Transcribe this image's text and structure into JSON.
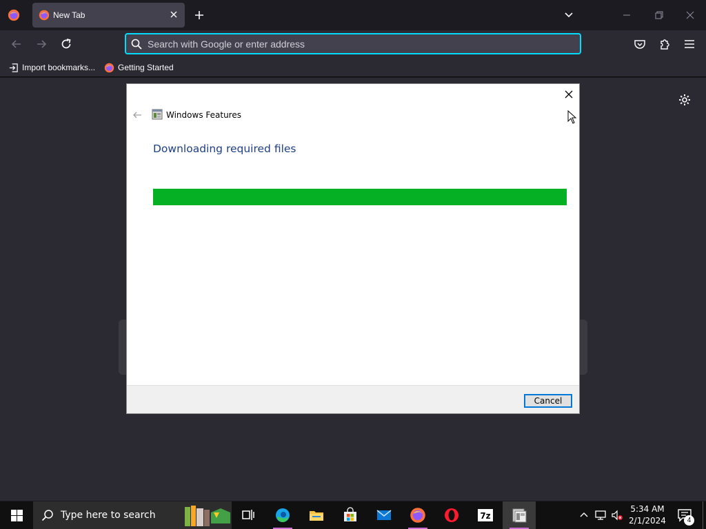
{
  "browser": {
    "tab": {
      "title": "New Tab"
    },
    "urlbar": {
      "placeholder": "Search with Google or enter address"
    },
    "bookmarks": [
      {
        "label": "Import bookmarks..."
      },
      {
        "label": "Getting Started"
      }
    ]
  },
  "dialog": {
    "window_title": "Windows Features",
    "heading": "Downloading required files",
    "progress_fraction": 1.0,
    "cancel_label": "Cancel"
  },
  "taskbar": {
    "search_placeholder": "Type here to search",
    "time": "5:34 AM",
    "date": "2/1/2024",
    "notification_count": "4",
    "apps": [
      "task-view",
      "edge",
      "file-explorer",
      "microsoft-store",
      "mail",
      "firefox",
      "opera",
      "7zip",
      "windows-features"
    ]
  },
  "colors": {
    "accent": "#00ddff",
    "progress": "#06b025",
    "heading": "#1e3f86",
    "button_border": "#0078d7"
  }
}
